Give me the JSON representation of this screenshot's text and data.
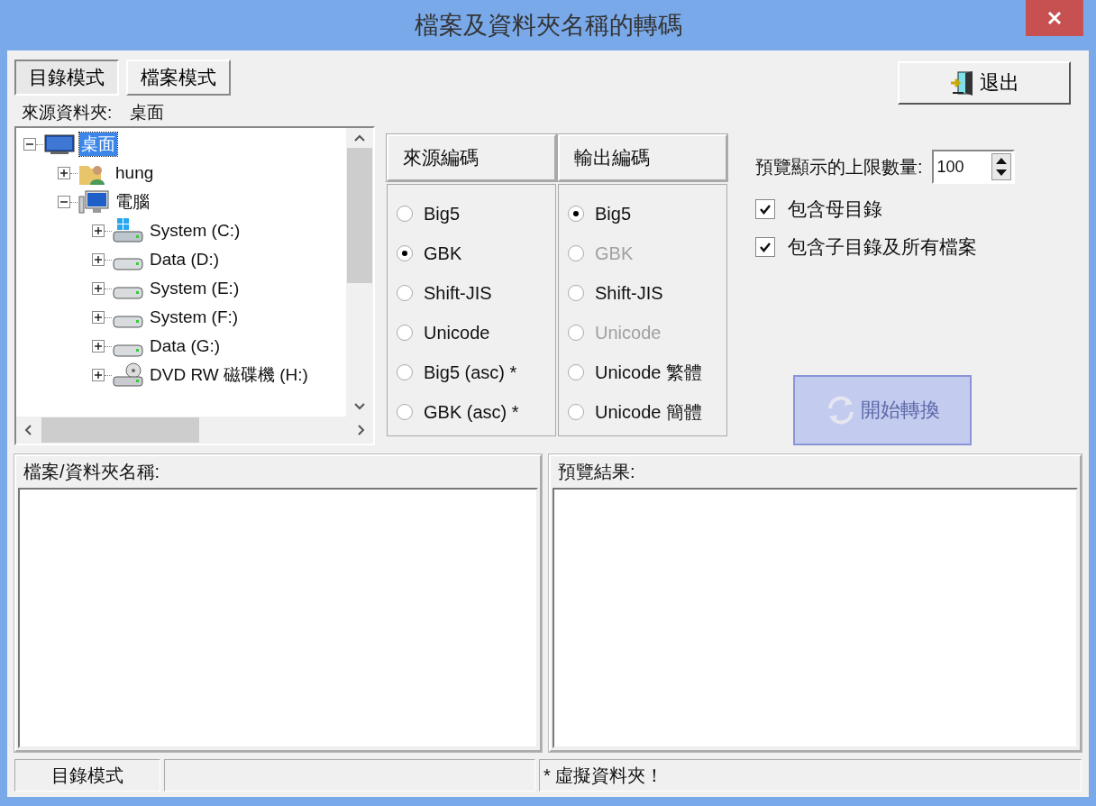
{
  "window": {
    "title": "檔案及資料夾名稱的轉碼"
  },
  "mode_tabs": [
    {
      "label": "目錄模式",
      "selected": true
    },
    {
      "label": "檔案模式",
      "selected": false
    }
  ],
  "exit_button": {
    "label": "退出"
  },
  "source_folder": {
    "label": "來源資料夾:",
    "value": "桌面"
  },
  "tree": [
    {
      "label": "桌面",
      "kind": "desktop",
      "expanded": true,
      "selected": true,
      "children": [
        {
          "label": "hung",
          "kind": "user",
          "expanded": false,
          "selected": false
        },
        {
          "label": "電腦",
          "kind": "computer",
          "expanded": true,
          "selected": false,
          "children": [
            {
              "label": "System (C:)",
              "kind": "system-drive",
              "expanded": false,
              "selected": false
            },
            {
              "label": "Data (D:)",
              "kind": "drive",
              "expanded": false,
              "selected": false
            },
            {
              "label": "System (E:)",
              "kind": "drive",
              "expanded": false,
              "selected": false
            },
            {
              "label": "System (F:)",
              "kind": "drive",
              "expanded": false,
              "selected": false
            },
            {
              "label": "Data (G:)",
              "kind": "drive",
              "expanded": false,
              "selected": false
            },
            {
              "label": "DVD RW 磁碟機 (H:)",
              "kind": "dvd",
              "expanded": false,
              "selected": false
            }
          ]
        }
      ]
    }
  ],
  "encodings": {
    "source_header": "來源編碼",
    "output_header": "輸出編碼",
    "source": [
      {
        "label": "Big5",
        "selected": false
      },
      {
        "label": "GBK",
        "selected": true
      },
      {
        "label": "Shift-JIS",
        "selected": false
      },
      {
        "label": "Unicode",
        "selected": false
      },
      {
        "label": "Big5 (asc) *",
        "selected": false
      },
      {
        "label": "GBK (asc) *",
        "selected": false
      }
    ],
    "output": [
      {
        "label": "Big5",
        "selected": true,
        "disabled": false
      },
      {
        "label": "GBK",
        "selected": false,
        "disabled": true
      },
      {
        "label": "Shift-JIS",
        "selected": false,
        "disabled": false
      },
      {
        "label": "Unicode",
        "selected": false,
        "disabled": true
      },
      {
        "label": "Unicode 繁體",
        "selected": false,
        "disabled": false
      },
      {
        "label": "Unicode 簡體",
        "selected": false,
        "disabled": false
      }
    ]
  },
  "preview_limit": {
    "label": "預覽顯示的上限數量:",
    "value": "100"
  },
  "options": [
    {
      "label": "包含母目錄",
      "checked": true
    },
    {
      "label": "包含子目錄及所有檔案",
      "checked": true
    }
  ],
  "start_button": {
    "label": "開始轉換",
    "disabled": true
  },
  "panels": [
    {
      "title": "檔案/資料夾名稱:"
    },
    {
      "title": "預覽結果:"
    }
  ],
  "status_bar": {
    "mode": "目錄模式",
    "message": "* 虛擬資料夾！"
  }
}
